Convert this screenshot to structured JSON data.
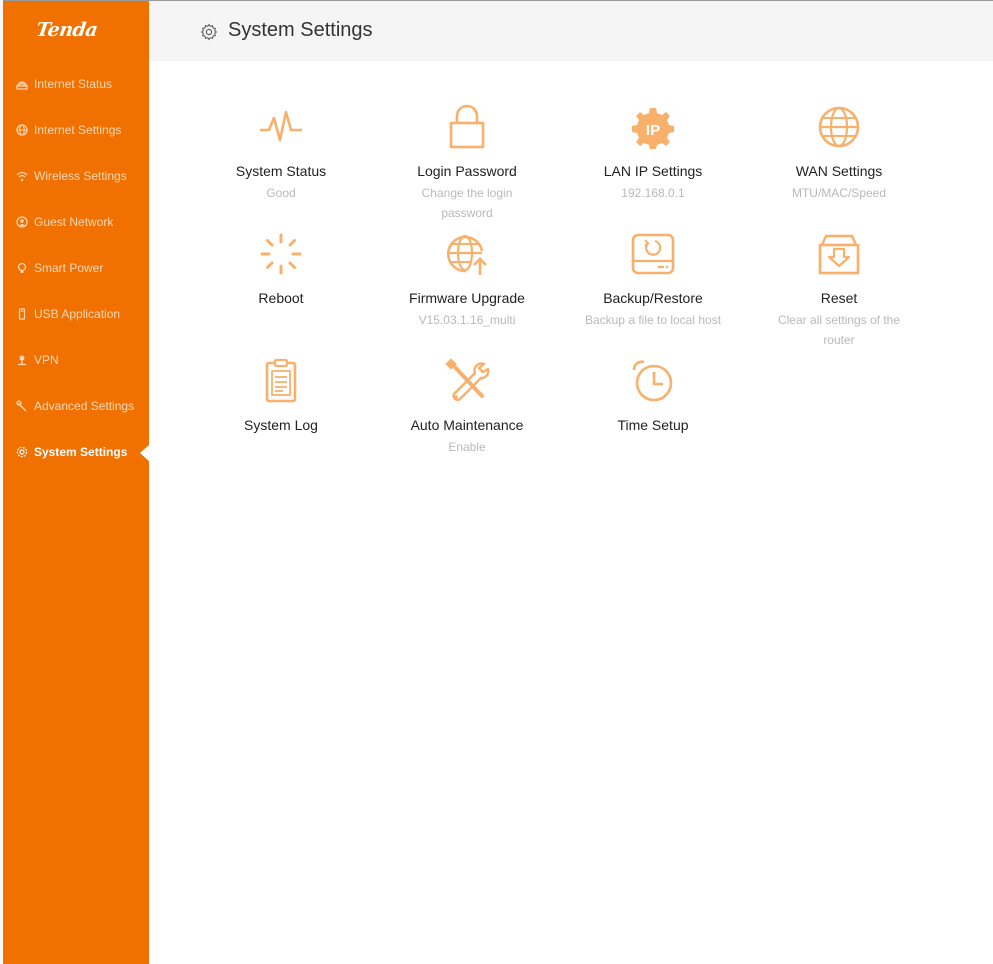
{
  "brand": {
    "logo_text": "Tenda",
    "accent": "#f07000",
    "icon_color": "#f8b06a"
  },
  "sidebar": {
    "items": [
      {
        "label": "Internet Status",
        "icon": "globe-router-icon"
      },
      {
        "label": "Internet Settings",
        "icon": "globe-icon"
      },
      {
        "label": "Wireless Settings",
        "icon": "wifi-icon"
      },
      {
        "label": "Guest Network",
        "icon": "guest-icon"
      },
      {
        "label": "Smart Power",
        "icon": "bulb-icon"
      },
      {
        "label": "USB Application",
        "icon": "usb-icon"
      },
      {
        "label": "VPN",
        "icon": "vpn-icon"
      },
      {
        "label": "Advanced Settings",
        "icon": "wrench-icon"
      },
      {
        "label": "System Settings",
        "icon": "gear-icon",
        "active": true
      }
    ]
  },
  "header": {
    "title": "System Settings",
    "icon": "gear-icon"
  },
  "tiles": [
    {
      "label": "System Status",
      "sub": "Good",
      "icon": "pulse-icon"
    },
    {
      "label": "Login Password",
      "sub": "Change the login password",
      "icon": "lock-icon"
    },
    {
      "label": "LAN IP Settings",
      "sub": "192.168.0.1",
      "icon": "ip-gear-icon"
    },
    {
      "label": "WAN Settings",
      "sub": "MTU/MAC/Speed",
      "icon": "globe-icon"
    },
    {
      "label": "Reboot",
      "sub": "",
      "icon": "spinner-icon"
    },
    {
      "label": "Firmware Upgrade",
      "sub": "V15.03.1.16_multi",
      "icon": "globe-upload-icon"
    },
    {
      "label": "Backup/Restore",
      "sub": "Backup a file to local host",
      "icon": "disk-restore-icon"
    },
    {
      "label": "Reset",
      "sub": "Clear all settings of the router",
      "icon": "box-reset-icon"
    },
    {
      "label": "System Log",
      "sub": "",
      "icon": "log-clipboard-icon"
    },
    {
      "label": "Auto Maintenance",
      "sub": "Enable",
      "icon": "tools-icon"
    },
    {
      "label": "Time Setup",
      "sub": "",
      "icon": "alarm-clock-icon"
    }
  ]
}
